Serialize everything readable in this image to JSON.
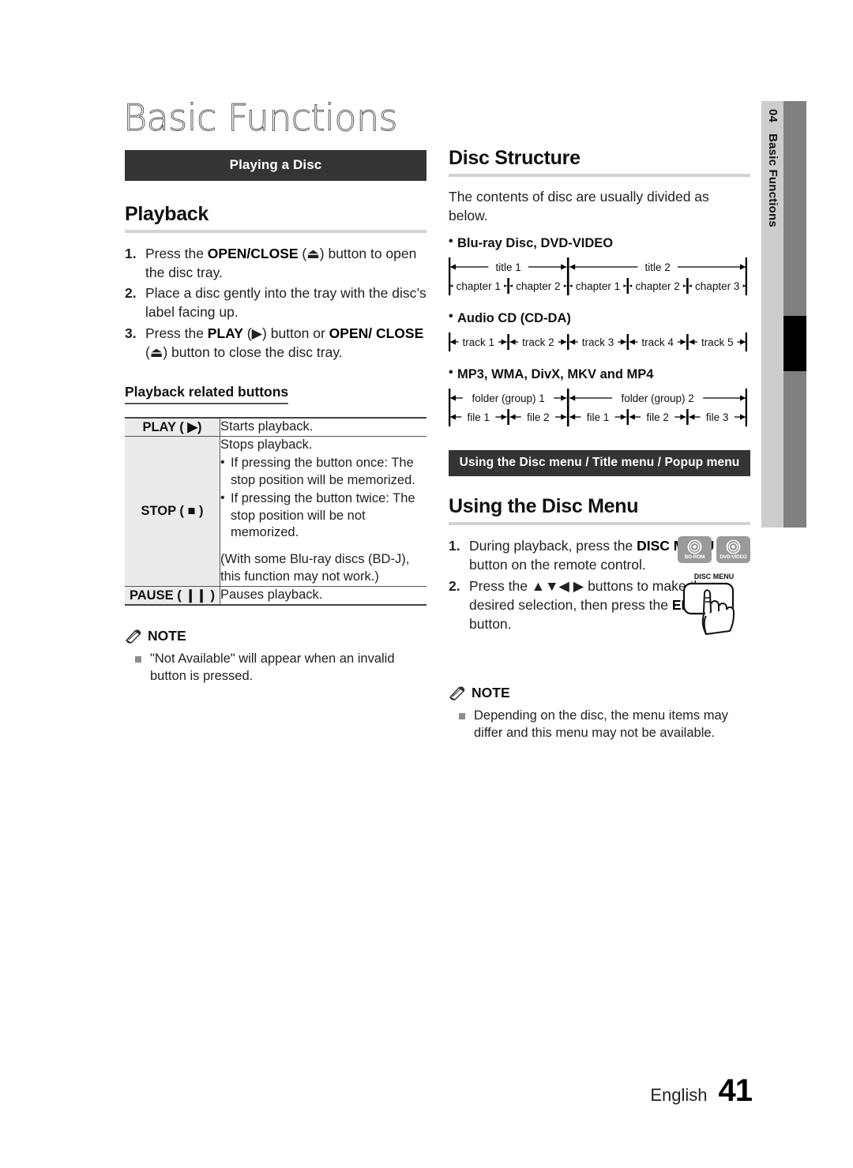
{
  "chapter": {
    "title": "Basic Functions",
    "tab_number": "04",
    "tab_label": "Basic Functions"
  },
  "left_column": {
    "banner": "Playing a Disc",
    "playback": {
      "heading": "Playback",
      "steps": [
        {
          "num": "1.",
          "parts": [
            {
              "t": "Press the ",
              "b": false
            },
            {
              "t": "OPEN/CLOSE",
              "b": true
            },
            {
              "t": " (⏏) button to open the disc tray.",
              "b": false
            }
          ]
        },
        {
          "num": "2.",
          "parts": [
            {
              "t": "Place a disc gently into the tray with the disc’s label facing up.",
              "b": false
            }
          ]
        },
        {
          "num": "3.",
          "parts": [
            {
              "t": "Press the ",
              "b": false
            },
            {
              "t": "PLAY",
              "b": true
            },
            {
              "t": " (▶) button or ",
              "b": false
            },
            {
              "t": "OPEN/ CLOSE",
              "b": true
            },
            {
              "t": " (⏏) button to close the disc tray.",
              "b": false
            }
          ]
        }
      ]
    },
    "related_buttons": {
      "heading": "Playback related buttons",
      "rows": [
        {
          "key": "PLAY ( ▶)",
          "lead": "Starts playback.",
          "bullets": [],
          "paren": ""
        },
        {
          "key": "STOP ( ■ )",
          "lead": "Stops playback.",
          "bullets": [
            "If pressing the button once: The stop position will be memorized.",
            "If pressing the button twice: The stop position will be not memorized."
          ],
          "paren": "(With some Blu-ray discs (BD-J), this function may not work.)"
        },
        {
          "key": "PAUSE ( ❙❙ )",
          "lead": "Pauses playback.",
          "bullets": [],
          "paren": ""
        }
      ]
    },
    "note": {
      "title": "NOTE",
      "items": [
        "\"Not Available\" will appear when an invalid button is pressed."
      ]
    }
  },
  "right_column": {
    "disc_structure": {
      "heading": "Disc Structure",
      "intro": "The contents of disc are usually divided as below.",
      "groups": [
        {
          "label": "Blu-ray Disc, DVD-VIDEO",
          "top_row": [
            "title 1",
            "title 2"
          ],
          "bottom_row": [
            "chapter 1",
            "chapter 2",
            "chapter 1",
            "chapter 2",
            "chapter 3"
          ],
          "top_spans": [
            2,
            3
          ]
        },
        {
          "label": "Audio CD (CD-DA)",
          "top_row": [],
          "bottom_row": [
            "track 1",
            "track 2",
            "track 3",
            "track 4",
            "track 5"
          ],
          "top_spans": []
        },
        {
          "label": "MP3, WMA, DivX, MKV and MP4",
          "top_row": [
            "folder (group) 1",
            "folder (group) 2"
          ],
          "bottom_row": [
            "file 1",
            "file 2",
            "file 1",
            "file 2",
            "file 3"
          ],
          "top_spans": [
            2,
            3
          ]
        }
      ]
    },
    "disc_menu": {
      "banner": "Using the Disc menu / Title menu / Popup menu",
      "heading": "Using the Disc Menu",
      "media_icons": [
        "BD-ROM",
        "DVD-VIDEO"
      ],
      "remote_button_label": "DISC MENU",
      "steps": [
        {
          "num": "1.",
          "parts": [
            {
              "t": "During playback, press the ",
              "b": false
            },
            {
              "t": "DISC MENU",
              "b": true
            },
            {
              "t": "  button on the remote control.",
              "b": false
            }
          ]
        },
        {
          "num": "2.",
          "parts": [
            {
              "t": "Press the ▲▼◀ ▶ buttons to make the desired selection, then press the ",
              "b": false
            },
            {
              "t": "ENTER",
              "b": true
            },
            {
              "t": " button.",
              "b": false
            }
          ]
        }
      ]
    },
    "note": {
      "title": "NOTE",
      "items": [
        "Depending on the disc, the menu items may differ and this menu may not be available."
      ]
    }
  },
  "footer": {
    "language": "English",
    "page_number": "41"
  },
  "colors": {
    "banner_bg": "#343434",
    "rule": "#d2d2d2",
    "table_key_bg": "#ebebeb",
    "tab_light": "#cdcdcd",
    "tab_dark": "#808080",
    "icon_gray": "#9a9a9a"
  }
}
